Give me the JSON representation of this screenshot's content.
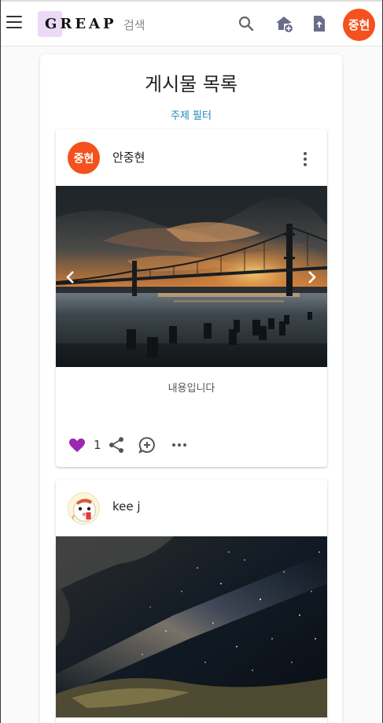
{
  "app": {
    "logo_text": "GREAP",
    "search_text": "검색",
    "user_avatar_text": "중현",
    "accent_color": "#f4511e",
    "icons": [
      "menu-icon",
      "search-icon",
      "add-home-icon",
      "upload-file-icon"
    ]
  },
  "main": {
    "title": "게시물 목록",
    "topic_filter": "주제 필터"
  },
  "posts": [
    {
      "author": "안중현",
      "avatar_text": "중현",
      "image": "bridge-sunset-photo",
      "content": "내용입니다",
      "likes": "1",
      "liked": true,
      "actions": [
        "favorite-icon",
        "share-icon",
        "add-comment-icon",
        "more-horiz-icon"
      ]
    },
    {
      "author": "kee j",
      "avatar_image": "cartoon-avatar",
      "image": "night-sky-photo"
    }
  ]
}
